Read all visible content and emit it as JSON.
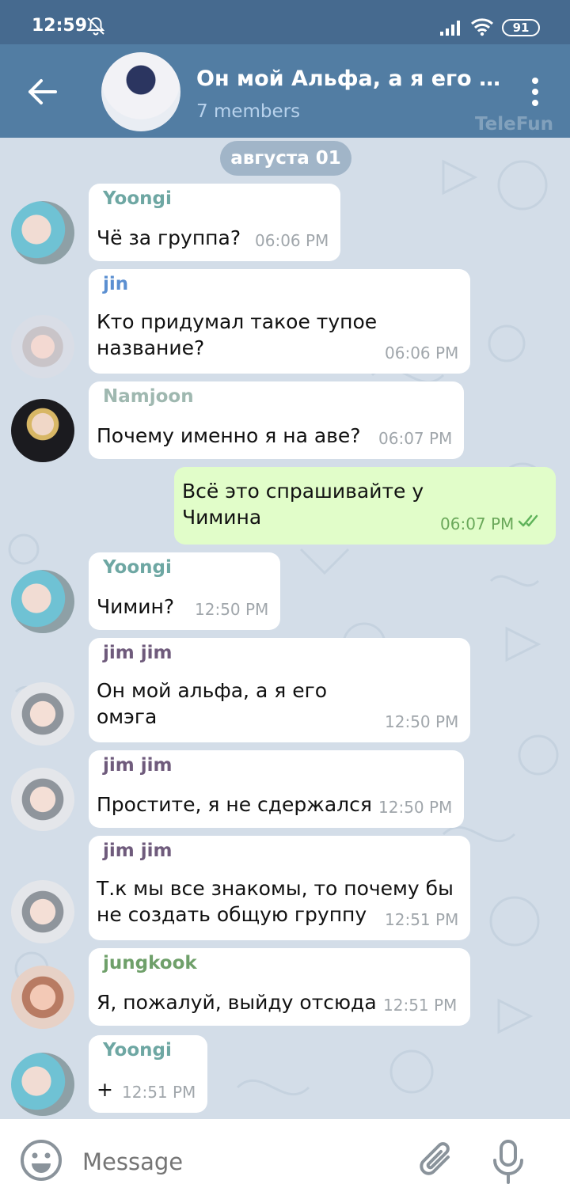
{
  "status_bar": {
    "time": "12:59",
    "battery": "91"
  },
  "header": {
    "title": "Он мой Альфа, а я его Ом…",
    "subtitle": "7 members",
    "watermark": "TeleFun"
  },
  "date_divider": "августа 01",
  "messages": [
    {
      "sender": "Yoongi",
      "sender_color": "#6ea7a3",
      "text": "Чё за группа?",
      "time": "06:06 PM",
      "direction": "in"
    },
    {
      "sender": "jin",
      "sender_color": "#5b8fd1",
      "text": "Кто придумал такое тупое\nназвание?",
      "time": "06:06 PM",
      "direction": "in"
    },
    {
      "sender": "Namjoon",
      "sender_color": "#9fb8b0",
      "text": "Почему именно я на аве?",
      "time": "06:07 PM",
      "direction": "in"
    },
    {
      "sender": "",
      "text": "Всё это спрашивайте у\nЧимина",
      "time": "06:07 PM",
      "direction": "out",
      "read": true
    },
    {
      "sender": "Yoongi",
      "sender_color": "#6ea7a3",
      "text": "Чимин?",
      "time": "12:50 PM",
      "direction": "in"
    },
    {
      "sender": "jim jim",
      "sender_color": "#6f5b7c",
      "text": "Он мой альфа, а я его\nомэга",
      "time": "12:50 PM",
      "direction": "in"
    },
    {
      "sender": "jim jim",
      "sender_color": "#6f5b7c",
      "text": "Простите, я не сдержался",
      "time": "12:50 PM",
      "direction": "in"
    },
    {
      "sender": "jim jim",
      "sender_color": "#6f5b7c",
      "text": "Т.к мы все знакомы, то почему бы\nне создать общую группу",
      "time": "12:51 PM",
      "direction": "in"
    },
    {
      "sender": "jungkook",
      "sender_color": "#6fa06a",
      "text": "Я, пожалуй, выйду отсюда",
      "time": "12:51 PM",
      "direction": "in"
    },
    {
      "sender": "Yoongi",
      "sender_color": "#6ea7a3",
      "text": "+",
      "time": "12:51 PM",
      "direction": "in"
    }
  ],
  "input": {
    "placeholder": "Message"
  },
  "colors": {
    "status_bar": "#466a8f",
    "header": "#527da3",
    "outgoing_bubble": "#e1fdc9",
    "incoming_bubble": "#ffffff",
    "chat_background": "#d3dde8"
  },
  "icons": [
    "back-arrow-icon",
    "bell-off-icon",
    "signal-icon",
    "wifi-icon",
    "more-vertical-icon",
    "emoji-icon",
    "paperclip-icon",
    "microphone-icon",
    "double-check-icon"
  ]
}
